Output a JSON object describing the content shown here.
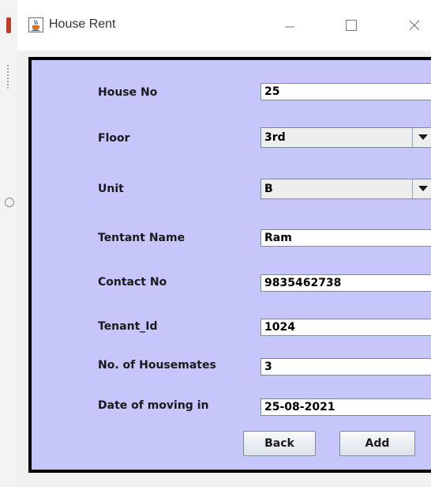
{
  "window": {
    "title": "House Rent"
  },
  "form": {
    "fields": [
      {
        "label": "House No",
        "value": "25"
      },
      {
        "label": "Floor",
        "value": "3rd"
      },
      {
        "label": "Unit",
        "value": "B"
      },
      {
        "label": "Tentant Name",
        "value": "Ram"
      },
      {
        "label": "Contact No",
        "value": "9835462738"
      },
      {
        "label": "Tenant_Id",
        "value": "1024"
      },
      {
        "label": "No. of Housemates",
        "value": "3"
      },
      {
        "label": "Date of moving in",
        "value": "25-08-2021"
      }
    ],
    "buttons": {
      "back": "Back",
      "add": "Add"
    }
  },
  "colors": {
    "panel_background": "#c7c6fb",
    "panel_border": "#000000"
  },
  "icons": {
    "app": "java-cup-icon",
    "minimize": "minimize-icon",
    "maximize": "maximize-icon",
    "close": "close-icon",
    "dropdown": "triangle-down-icon"
  }
}
